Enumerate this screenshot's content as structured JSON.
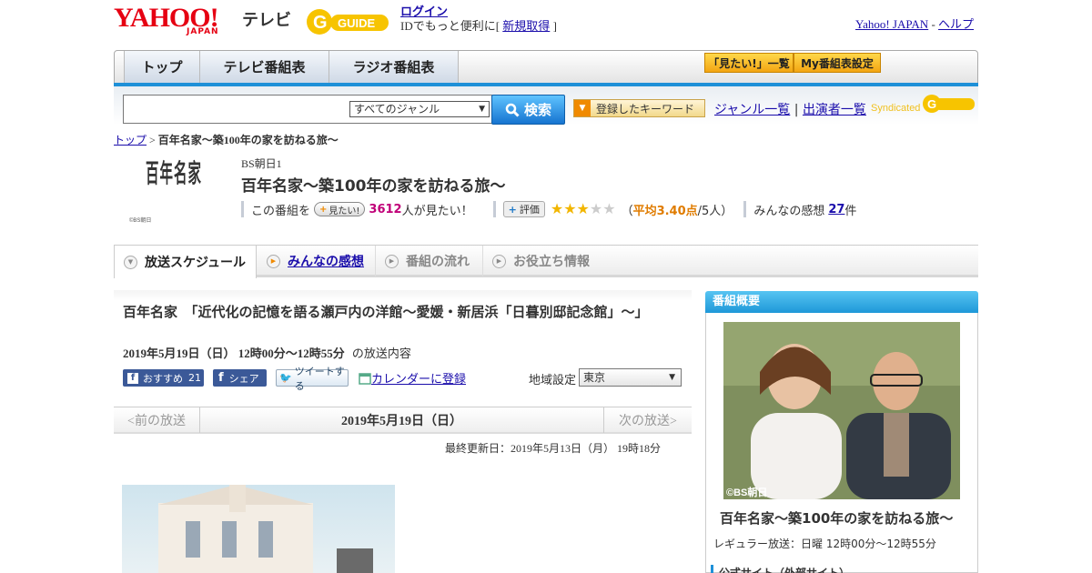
{
  "header": {
    "yahoo_logo": "YAHOO!",
    "japan_logo": "JAPAN",
    "tv_label": "テレビ",
    "gguide_logo": "G GUIDE",
    "login_link": "ログイン",
    "login_pre": "IDでもっと便利に[",
    "signup_link": "新規取得",
    "login_post": "]",
    "yahoo_japan_link": "Yahoo! JAPAN",
    "separator": "-",
    "help_link": "ヘルプ"
  },
  "nav": {
    "tabs": [
      "トップ",
      "テレビ番組表",
      "ラジオ番組表"
    ],
    "mitai_list": "「見たい!」一覧",
    "my_schedule": "My番組表設定"
  },
  "search": {
    "genre_selected": "すべてのジャンル",
    "search_button": "検索",
    "keyword_button": "登録したキーワード",
    "genre_list_link": "ジャンル一覧",
    "pipe": "|",
    "performer_list_link": "出演者一覧",
    "syndicated": "Syndicated"
  },
  "breadcrumb": {
    "top": "トップ",
    "sep": ">",
    "current": "百年名家～築100年の家を訪ねる旅～"
  },
  "program": {
    "logo_text": "百年名家",
    "logo_credit": "©BS朝日",
    "channel": "BS朝日1",
    "title": "百年名家～築100年の家を訪ねる旅～",
    "mitai_pre": "この番組を",
    "mitai_button": "見たい!",
    "mitai_count": "3612",
    "mitai_post": "人が見たい！",
    "rating_button": "評価",
    "rating_stars": 3,
    "rating_max": 5,
    "rating_open": "（",
    "rating_avg": "平均3.40点",
    "rating_people": "/5人）",
    "impressions_pre": "みんなの感想",
    "impressions_count": "27",
    "impressions_post": "件"
  },
  "tabs": {
    "schedule": "放送スケジュール",
    "impressions": "みんなの感想",
    "flow": "番組の流れ",
    "useful": "お役立ち情報"
  },
  "episode": {
    "title": "百年名家　「近代化の記憶を語る瀬戸内の洋館～愛媛・新居浜「日暮別邸記念館」～」",
    "datetime": "2019年5月19日（日）  12時00分～12時55分",
    "datetime_suffix": "の放送内容",
    "recommend": "おすすめ",
    "recommend_count": "21",
    "share": "シェア",
    "tweet": "ツイートする",
    "calendar": "カレンダーに登録",
    "region_label": "地域設定",
    "region_selected": "東京",
    "prev": "<前の放送",
    "current_date": "2019年5月19日（日）",
    "next": "次の放送>",
    "updated": "最終更新日：2019年5月13日（月）  19時18分"
  },
  "sidebar": {
    "heading": "番組概要",
    "image_credit": "©BS朝日",
    "title": "百年名家～築100年の家を訪ねる旅～",
    "regular": "レギュラー放送：日曜 12時00分～12時55分",
    "official_site": "公式サイト（外部サイト）"
  },
  "colors": {
    "yahoo_red": "#e60012",
    "nav_blue": "#1e90d8",
    "star": "#f2b600",
    "accent_pink": "#c00078",
    "accent_orange": "#e07c00"
  }
}
